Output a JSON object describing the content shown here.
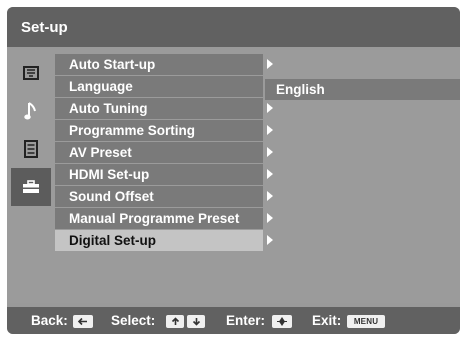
{
  "header": {
    "title": "Set-up"
  },
  "sidebar": {
    "icons": [
      "picture-icon",
      "music-note-icon",
      "list-icon",
      "toolbox-icon"
    ],
    "selected_index": 3
  },
  "menu": {
    "items": [
      {
        "label": "Auto Start-up"
      },
      {
        "label": "Language"
      },
      {
        "label": "Auto Tuning"
      },
      {
        "label": "Programme Sorting"
      },
      {
        "label": "AV Preset"
      },
      {
        "label": "HDMI Set-up"
      },
      {
        "label": "Sound Offset"
      },
      {
        "label": "Manual Programme Preset"
      },
      {
        "label": "Digital Set-up"
      }
    ],
    "selected_index": 8,
    "language_value": "English"
  },
  "footer": {
    "back_label": "Back:",
    "select_label": "Select:",
    "enter_label": "Enter:",
    "exit_label": "Exit:",
    "menu_key": "MENU"
  },
  "colors": {
    "header_bg": "#616161",
    "panel_bg": "#9b9b9b",
    "item_bg": "#7a7a7a",
    "item_selected_bg": "#c4c4c4",
    "text": "#ffffff"
  }
}
